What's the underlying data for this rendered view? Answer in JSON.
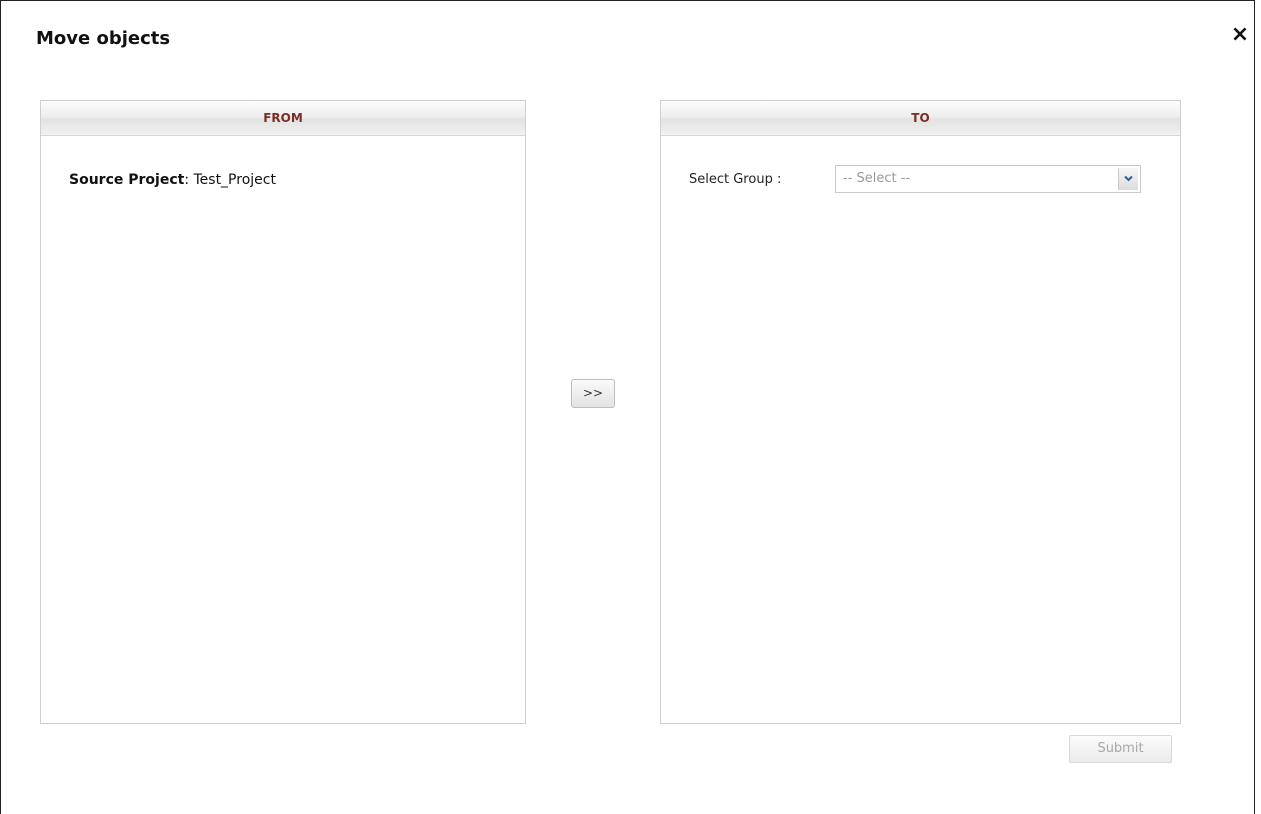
{
  "dialog": {
    "title": "Move objects",
    "close_glyph": "×"
  },
  "from_panel": {
    "header": "FROM",
    "source_label": "Source Project",
    "source_separator": ":",
    "source_value": "Test_Project"
  },
  "to_panel": {
    "header": "TO",
    "group_label": "Select Group :",
    "group_select_value": "-- Select --"
  },
  "actions": {
    "move_label": ">>",
    "submit_label": "Submit"
  },
  "icons": {
    "close": "close-icon",
    "dropdown": "chevron-down-icon"
  },
  "colors": {
    "panel_header_text": "#7a2e24",
    "dropdown_arrow": "#2b5e9e"
  }
}
